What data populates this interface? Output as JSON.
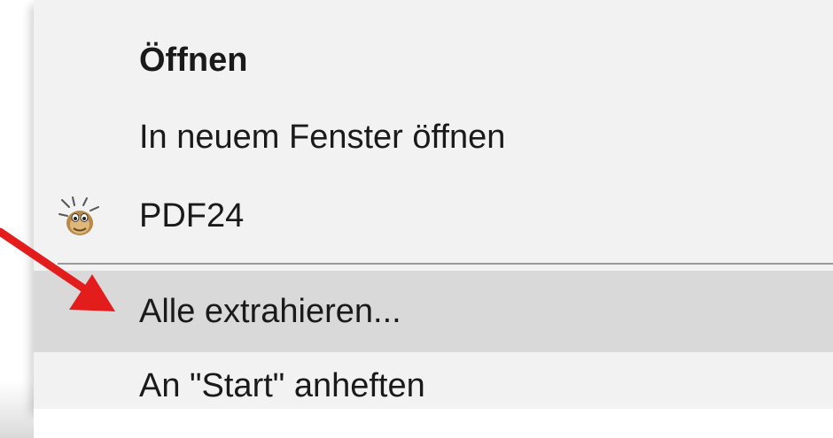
{
  "context_menu": {
    "items": [
      {
        "label": "Öffnen",
        "bold": true
      },
      {
        "label": "In neuem Fenster öffnen"
      },
      {
        "label": "PDF24",
        "icon": "pdf24-icon"
      },
      {
        "label": "Alle extrahieren...",
        "highlighted": true
      },
      {
        "label": "An \"Start\" anheften"
      }
    ]
  },
  "annotation": {
    "arrow_color": "#e31c1c",
    "points_to": "Alle extrahieren..."
  }
}
